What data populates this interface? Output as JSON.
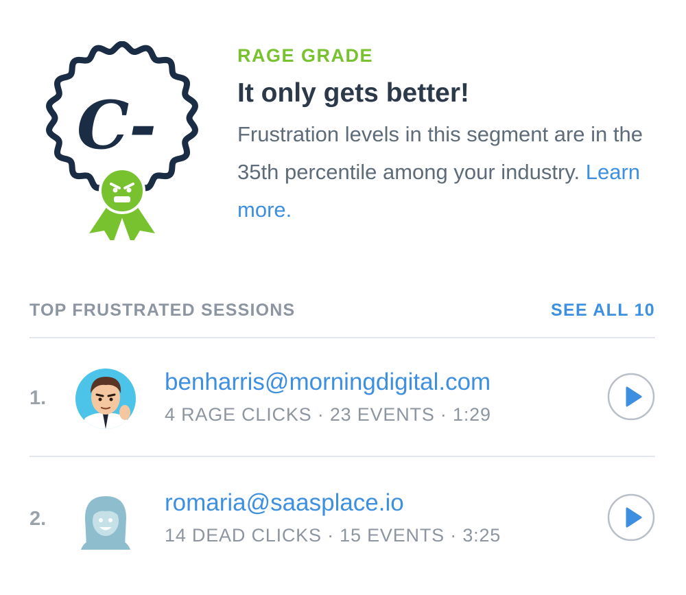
{
  "rage_grade": {
    "eyebrow": "RAGE GRADE",
    "grade": "C-",
    "headline": "It only gets better!",
    "description": "Frustration levels in this segment are in the 35th percentile among your industry. ",
    "link_label": "Learn more.",
    "badge_icon": "angry-face-ribbon-icon",
    "colors": {
      "badge_outline": "#1b2d45",
      "accent_green": "#78c22f",
      "link_blue": "#3d8fe0"
    }
  },
  "top_sessions": {
    "title": "TOP FRUSTRATED SESSIONS",
    "see_all_label": "SEE ALL 10",
    "items": [
      {
        "index": "1.",
        "email": "benharris@morningdigital.com",
        "meta": "4 RAGE CLICKS · 23 EVENTS · 1:29",
        "avatar": "cartoon-man-avatar",
        "action_icon": "play-icon"
      },
      {
        "index": "2.",
        "email": "romaria@saasplace.io",
        "meta": "14 DEAD CLICKS · 15 EVENTS · 3:25",
        "avatar": "default-woman-avatar",
        "action_icon": "play-icon"
      }
    ]
  }
}
